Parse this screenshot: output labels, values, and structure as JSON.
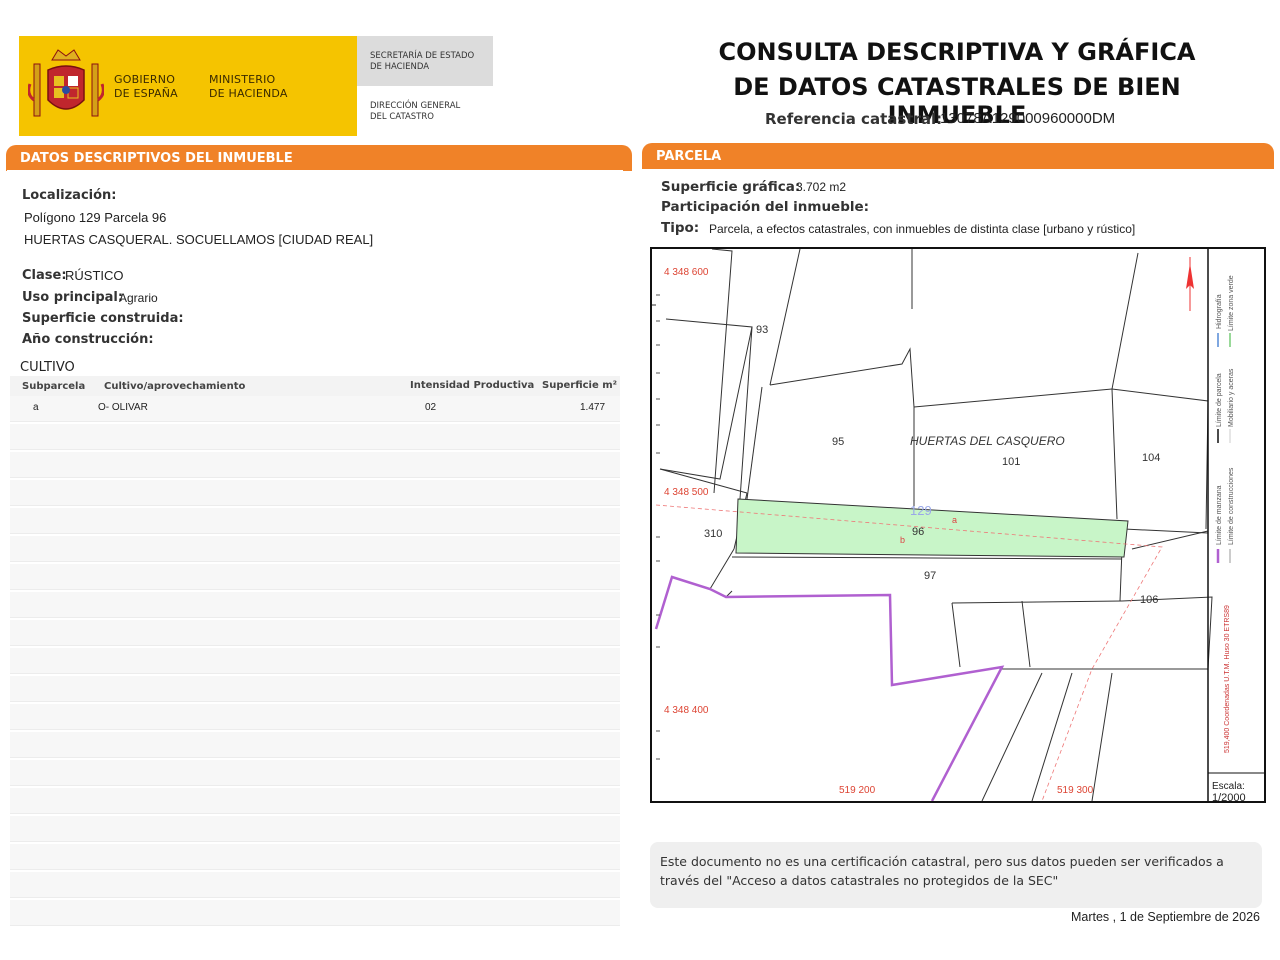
{
  "header": {
    "gov_line1": "GOBIERNO",
    "gov_line2": "DE ESPAÑA",
    "ministry_line1": "MINISTERIO",
    "ministry_line2": "DE HACIENDA",
    "secretaria_line1": "SECRETARÍA DE ESTADO",
    "secretaria_line2": "DE HACIENDA",
    "direccion_line1": "DIRECCIÓN GENERAL",
    "direccion_line2": "DEL CATASTRO",
    "title_line1": "CONSULTA DESCRIPTIVA Y GRÁFICA",
    "title_line2": "DE DATOS CATASTRALES DE BIEN INMUEBLE",
    "ref_label": "Referencia catastral:",
    "ref_value": "13078A129000960000DM"
  },
  "left_section": {
    "title": "DATOS DESCRIPTIVOS DEL INMUEBLE",
    "localizacion_label": "Localización:",
    "localizacion_line1": "Polígono 129 Parcela 96",
    "localizacion_line2": "HUERTAS CASQUERAL. SOCUELLAMOS [CIUDAD REAL]",
    "clase_label": "Clase:",
    "clase_value": "RÚSTICO",
    "uso_label": "Uso principal:",
    "uso_value": "Agrario",
    "superficie_construida_label": "Superficie construida:",
    "anio_label": "Año construcción:",
    "cultivo_title": "CULTIVO",
    "table_headers": [
      "Subparcela",
      "Cultivo/aprovechamiento",
      "Intensidad Productiva",
      "Superficie m²"
    ],
    "table_rows": [
      {
        "subparcela": "a",
        "cultivo": "O- OLIVAR",
        "intensidad": "02",
        "superficie": "1.477"
      }
    ]
  },
  "right_section": {
    "title": "PARCELA",
    "superficie_grafica_label": "Superficie gráfica:",
    "superficie_grafica_value": "3.702 m2",
    "participacion_label": "Participación del inmueble:",
    "tipo_label": "Tipo:",
    "tipo_value": "Parcela, a efectos catastrales, con inmuebles de distinta clase [urbano y rústico]"
  },
  "map": {
    "parcel_labels": [
      "93",
      "95",
      "101",
      "104",
      "310",
      "96",
      "97",
      "106",
      "129",
      "a",
      "b"
    ],
    "place_name": "HUERTAS DEL CASQUERO",
    "coord_y": [
      "4 348 600",
      "4 348 500",
      "4 348 400"
    ],
    "coord_x": [
      "519 200",
      "519 300"
    ],
    "legend_col1": [
      "Límite de manzana",
      "Límite de parcela",
      "Hidrografía"
    ],
    "legend_col2": [
      "Límite de construcciones",
      "Mobiliario y aceras",
      "Límite zona verde"
    ],
    "legend_coords": "519,400 Coordenadas U.T.M. Huso 30 ETRS89",
    "scale_label": "Escala:",
    "scale_value": "1/2000",
    "parcel_color": "#c8f5c8",
    "boundary_color": "#b060d0"
  },
  "footer": {
    "disclaimer": "Este documento no es una certificación catastral, pero sus datos pueden ser verificados a través del \"Acceso a datos catastrales no protegidos de la SEC\"",
    "date": "Martes , 1 de Septiembre de 2026"
  },
  "colors": {
    "accent_orange": "#f08228",
    "logo_yellow": "#f5c400"
  }
}
